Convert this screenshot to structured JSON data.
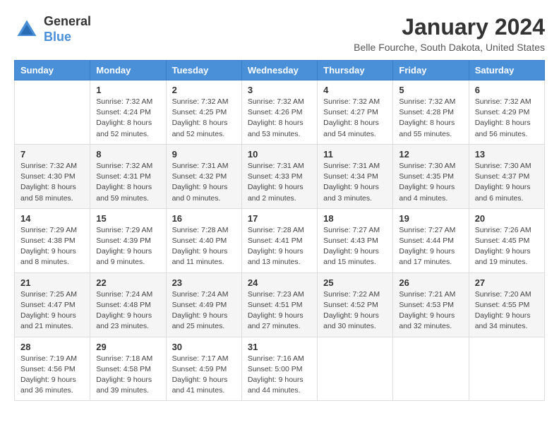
{
  "header": {
    "logo": {
      "general": "General",
      "blue": "Blue"
    },
    "title": "January 2024",
    "location": "Belle Fourche, South Dakota, United States"
  },
  "calendar": {
    "headers": [
      "Sunday",
      "Monday",
      "Tuesday",
      "Wednesday",
      "Thursday",
      "Friday",
      "Saturday"
    ],
    "weeks": [
      [
        {
          "day": "",
          "info": ""
        },
        {
          "day": "1",
          "info": "Sunrise: 7:32 AM\nSunset: 4:24 PM\nDaylight: 8 hours\nand 52 minutes."
        },
        {
          "day": "2",
          "info": "Sunrise: 7:32 AM\nSunset: 4:25 PM\nDaylight: 8 hours\nand 52 minutes."
        },
        {
          "day": "3",
          "info": "Sunrise: 7:32 AM\nSunset: 4:26 PM\nDaylight: 8 hours\nand 53 minutes."
        },
        {
          "day": "4",
          "info": "Sunrise: 7:32 AM\nSunset: 4:27 PM\nDaylight: 8 hours\nand 54 minutes."
        },
        {
          "day": "5",
          "info": "Sunrise: 7:32 AM\nSunset: 4:28 PM\nDaylight: 8 hours\nand 55 minutes."
        },
        {
          "day": "6",
          "info": "Sunrise: 7:32 AM\nSunset: 4:29 PM\nDaylight: 8 hours\nand 56 minutes."
        }
      ],
      [
        {
          "day": "7",
          "info": "Sunrise: 7:32 AM\nSunset: 4:30 PM\nDaylight: 8 hours\nand 58 minutes."
        },
        {
          "day": "8",
          "info": "Sunrise: 7:32 AM\nSunset: 4:31 PM\nDaylight: 8 hours\nand 59 minutes."
        },
        {
          "day": "9",
          "info": "Sunrise: 7:31 AM\nSunset: 4:32 PM\nDaylight: 9 hours\nand 0 minutes."
        },
        {
          "day": "10",
          "info": "Sunrise: 7:31 AM\nSunset: 4:33 PM\nDaylight: 9 hours\nand 2 minutes."
        },
        {
          "day": "11",
          "info": "Sunrise: 7:31 AM\nSunset: 4:34 PM\nDaylight: 9 hours\nand 3 minutes."
        },
        {
          "day": "12",
          "info": "Sunrise: 7:30 AM\nSunset: 4:35 PM\nDaylight: 9 hours\nand 4 minutes."
        },
        {
          "day": "13",
          "info": "Sunrise: 7:30 AM\nSunset: 4:37 PM\nDaylight: 9 hours\nand 6 minutes."
        }
      ],
      [
        {
          "day": "14",
          "info": "Sunrise: 7:29 AM\nSunset: 4:38 PM\nDaylight: 9 hours\nand 8 minutes."
        },
        {
          "day": "15",
          "info": "Sunrise: 7:29 AM\nSunset: 4:39 PM\nDaylight: 9 hours\nand 9 minutes."
        },
        {
          "day": "16",
          "info": "Sunrise: 7:28 AM\nSunset: 4:40 PM\nDaylight: 9 hours\nand 11 minutes."
        },
        {
          "day": "17",
          "info": "Sunrise: 7:28 AM\nSunset: 4:41 PM\nDaylight: 9 hours\nand 13 minutes."
        },
        {
          "day": "18",
          "info": "Sunrise: 7:27 AM\nSunset: 4:43 PM\nDaylight: 9 hours\nand 15 minutes."
        },
        {
          "day": "19",
          "info": "Sunrise: 7:27 AM\nSunset: 4:44 PM\nDaylight: 9 hours\nand 17 minutes."
        },
        {
          "day": "20",
          "info": "Sunrise: 7:26 AM\nSunset: 4:45 PM\nDaylight: 9 hours\nand 19 minutes."
        }
      ],
      [
        {
          "day": "21",
          "info": "Sunrise: 7:25 AM\nSunset: 4:47 PM\nDaylight: 9 hours\nand 21 minutes."
        },
        {
          "day": "22",
          "info": "Sunrise: 7:24 AM\nSunset: 4:48 PM\nDaylight: 9 hours\nand 23 minutes."
        },
        {
          "day": "23",
          "info": "Sunrise: 7:24 AM\nSunset: 4:49 PM\nDaylight: 9 hours\nand 25 minutes."
        },
        {
          "day": "24",
          "info": "Sunrise: 7:23 AM\nSunset: 4:51 PM\nDaylight: 9 hours\nand 27 minutes."
        },
        {
          "day": "25",
          "info": "Sunrise: 7:22 AM\nSunset: 4:52 PM\nDaylight: 9 hours\nand 30 minutes."
        },
        {
          "day": "26",
          "info": "Sunrise: 7:21 AM\nSunset: 4:53 PM\nDaylight: 9 hours\nand 32 minutes."
        },
        {
          "day": "27",
          "info": "Sunrise: 7:20 AM\nSunset: 4:55 PM\nDaylight: 9 hours\nand 34 minutes."
        }
      ],
      [
        {
          "day": "28",
          "info": "Sunrise: 7:19 AM\nSunset: 4:56 PM\nDaylight: 9 hours\nand 36 minutes."
        },
        {
          "day": "29",
          "info": "Sunrise: 7:18 AM\nSunset: 4:58 PM\nDaylight: 9 hours\nand 39 minutes."
        },
        {
          "day": "30",
          "info": "Sunrise: 7:17 AM\nSunset: 4:59 PM\nDaylight: 9 hours\nand 41 minutes."
        },
        {
          "day": "31",
          "info": "Sunrise: 7:16 AM\nSunset: 5:00 PM\nDaylight: 9 hours\nand 44 minutes."
        },
        {
          "day": "",
          "info": ""
        },
        {
          "day": "",
          "info": ""
        },
        {
          "day": "",
          "info": ""
        }
      ]
    ]
  }
}
